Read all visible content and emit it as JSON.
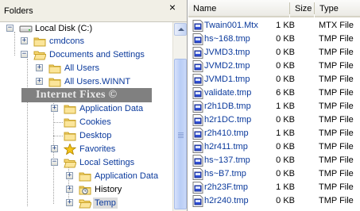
{
  "folders": {
    "title": "Folders",
    "close_glyph": "×",
    "tree": [
      {
        "label": "Local Disk (C:)",
        "expander": "−",
        "icon": "disk-icon",
        "indent": 0,
        "black": true
      },
      {
        "label": "cmdcons",
        "expander": "+",
        "icon": "folder-icon",
        "indent": 1
      },
      {
        "label": "Documents and Settings",
        "expander": "−",
        "icon": "open-folder-icon",
        "indent": 1
      },
      {
        "label": "All Users",
        "expander": "+",
        "icon": "folder-icon",
        "indent": 2
      },
      {
        "label": "All Users.WINNT",
        "expander": "+",
        "icon": "folder-icon",
        "indent": 2
      },
      {
        "label": "Application Data",
        "expander": "+",
        "icon": "folder-icon",
        "indent": 3
      },
      {
        "label": "Cookies",
        "expander": "",
        "icon": "folder-icon",
        "indent": 3
      },
      {
        "label": "Desktop",
        "expander": "",
        "icon": "folder-icon",
        "indent": 3
      },
      {
        "label": "Favorites",
        "expander": "+",
        "icon": "favorites-star-icon",
        "indent": 3
      },
      {
        "label": "Local Settings",
        "expander": "−",
        "icon": "open-folder-icon",
        "indent": 3
      },
      {
        "label": "Application Data",
        "expander": "+",
        "icon": "folder-icon",
        "indent": 4
      },
      {
        "label": "History",
        "expander": "+",
        "icon": "history-folder-icon",
        "indent": 4
      },
      {
        "label": "Temp",
        "expander": "+",
        "icon": "open-folder-icon",
        "indent": 4,
        "selected": true
      }
    ],
    "watermark": "Internet Fixes ©"
  },
  "files": {
    "columns": {
      "name": "Name",
      "size": "Size",
      "type": "Type"
    },
    "rows": [
      {
        "name": "Twain001.Mtx",
        "size": "1 KB",
        "type": "MTX File"
      },
      {
        "name": "hs~168.tmp",
        "size": "0 KB",
        "type": "TMP File"
      },
      {
        "name": "JVMD3.tmp",
        "size": "0 KB",
        "type": "TMP File"
      },
      {
        "name": "JVMD2.tmp",
        "size": "0 KB",
        "type": "TMP File"
      },
      {
        "name": "JVMD1.tmp",
        "size": "0 KB",
        "type": "TMP File"
      },
      {
        "name": "validate.tmp",
        "size": "6 KB",
        "type": "TMP File"
      },
      {
        "name": "r2h1DB.tmp",
        "size": "1 KB",
        "type": "TMP File"
      },
      {
        "name": "h2r1DC.tmp",
        "size": "0 KB",
        "type": "TMP File"
      },
      {
        "name": "r2h410.tmp",
        "size": "1 KB",
        "type": "TMP File"
      },
      {
        "name": "h2r411.tmp",
        "size": "0 KB",
        "type": "TMP File"
      },
      {
        "name": "hs~137.tmp",
        "size": "0 KB",
        "type": "TMP File"
      },
      {
        "name": "hs~B7.tmp",
        "size": "0 KB",
        "type": "TMP File"
      },
      {
        "name": "r2h23F.tmp",
        "size": "1 KB",
        "type": "TMP File"
      },
      {
        "name": "h2r240.tmp",
        "size": "0 KB",
        "type": "TMP File"
      }
    ]
  }
}
